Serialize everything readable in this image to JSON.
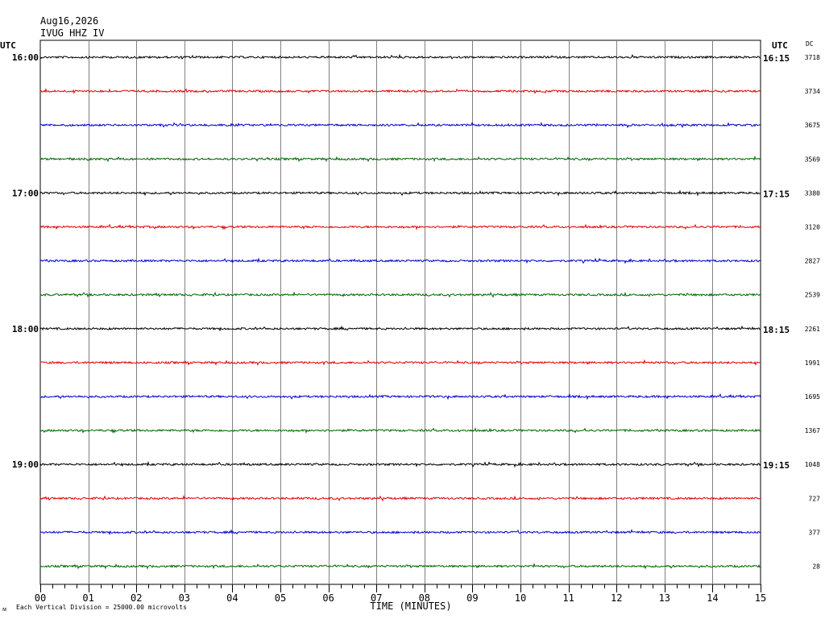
{
  "header": {
    "date": "Aug16,2026",
    "station": "IVUG HHZ IV"
  },
  "utc_left": "UTC",
  "utc_right": "UTC",
  "dc_header": "DC",
  "footer": {
    "note": "Each Vertical Division = 25000.00 microvolts",
    "mark": "ᴍ"
  },
  "chart_data": {
    "type": "line",
    "xlabel": "TIME (MINUTES)",
    "x_ticks": [
      "00",
      "01",
      "02",
      "03",
      "04",
      "05",
      "06",
      "07",
      "08",
      "09",
      "10",
      "11",
      "12",
      "13",
      "14",
      "15"
    ],
    "xlim": [
      0,
      15
    ],
    "grid": true,
    "trace_colors": [
      "#000000",
      "#e00000",
      "#0000cc",
      "#006600"
    ],
    "hour_labels_left": [
      {
        "row": 0,
        "text": "16:00"
      },
      {
        "row": 4,
        "text": "17:00"
      },
      {
        "row": 8,
        "text": "18:00"
      },
      {
        "row": 12,
        "text": "19:00"
      }
    ],
    "hour_labels_right": [
      {
        "row": 0,
        "text": "16:15"
      },
      {
        "row": 4,
        "text": "17:15"
      },
      {
        "row": 8,
        "text": "18:15"
      },
      {
        "row": 12,
        "text": "19:15"
      }
    ],
    "dc_offsets": [
      3718,
      3734,
      3675,
      3569,
      3380,
      3120,
      2827,
      2539,
      2261,
      1991,
      1695,
      1367,
      1048,
      727,
      377,
      28
    ]
  }
}
